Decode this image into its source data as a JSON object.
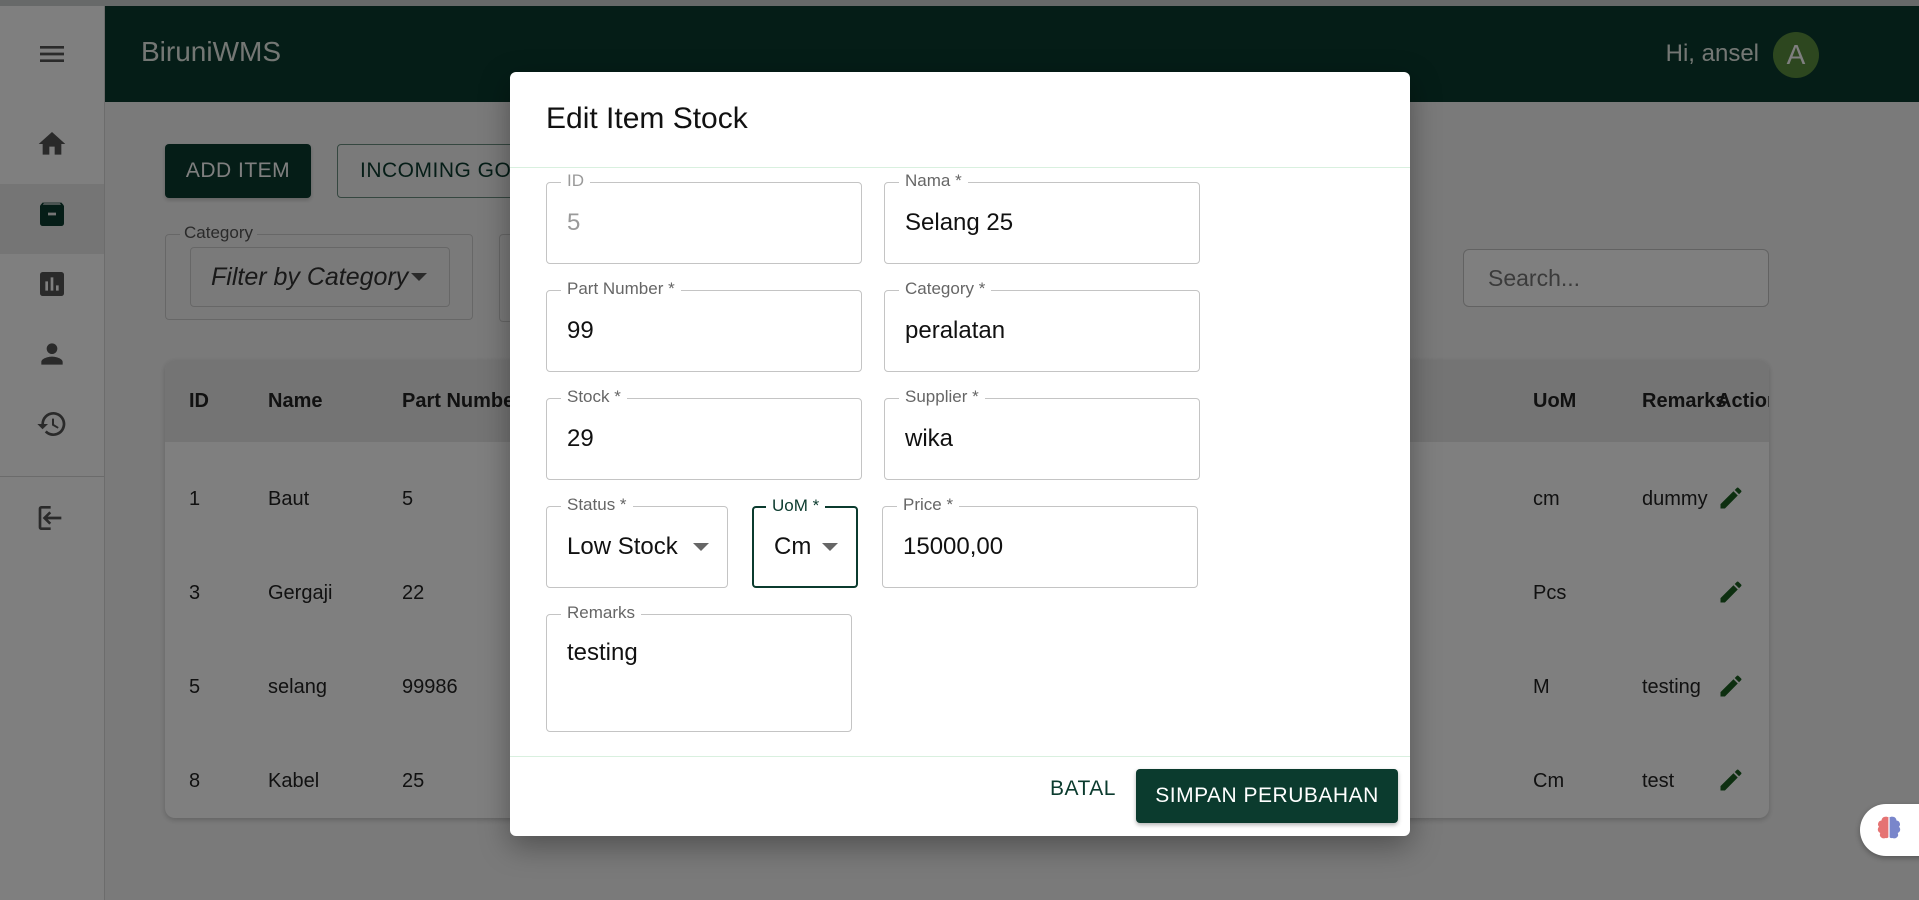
{
  "app": {
    "title": "BiruniWMS",
    "greeting": "Hi, ansel",
    "avatar_initial": "A"
  },
  "sidebar": {
    "items": [
      "menu-icon",
      "home-icon",
      "archive-icon",
      "chart-icon",
      "person-icon",
      "history-icon",
      "logout-icon"
    ]
  },
  "toolbar": {
    "add_label": "ADD ITEM",
    "incoming_label": "INCOMING GOODS"
  },
  "filter": {
    "legend": "Category",
    "value": "Filter by Category"
  },
  "search": {
    "placeholder": "Search..."
  },
  "table": {
    "columns": {
      "id": "ID",
      "name": "Name",
      "part": "Part Number",
      "uom": "UoM",
      "remarks": "Remarks",
      "action": "Action"
    },
    "rows": [
      {
        "id": "1",
        "name": "Baut",
        "part": "5",
        "uom": "cm",
        "remarks": "dummy"
      },
      {
        "id": "3",
        "name": "Gergaji",
        "part": "22",
        "uom": "Pcs",
        "remarks": ""
      },
      {
        "id": "5",
        "name": "selang",
        "part": "99986",
        "uom": "M",
        "remarks": "testing"
      },
      {
        "id": "8",
        "name": "Kabel",
        "part": "25",
        "uom": "Cm",
        "remarks": "test"
      }
    ]
  },
  "dialog": {
    "title": "Edit Item Stock",
    "fields": {
      "id": {
        "label": "ID",
        "value": "5"
      },
      "nama": {
        "label": "Nama *",
        "value": "Selang 25"
      },
      "part": {
        "label": "Part Number *",
        "value": "99"
      },
      "category": {
        "label": "Category *",
        "value": "peralatan"
      },
      "stock": {
        "label": "Stock *",
        "value": "29"
      },
      "supplier": {
        "label": "Supplier *",
        "value": "wika"
      },
      "status": {
        "label": "Status *",
        "value": "Low Stock"
      },
      "uom": {
        "label": "UoM *",
        "value": "Cm"
      },
      "price": {
        "label": "Price *",
        "value": "15000,00"
      },
      "remarks": {
        "label": "Remarks",
        "value": "testing"
      }
    },
    "cancel_label": "BATAL",
    "save_label": "SIMPAN PERUBAHAN"
  },
  "colors": {
    "primary": "#0b3b2e",
    "avatar": "#5a8f3e",
    "danger": "#c62828",
    "overlay": "rgba(0,0,0,0.5)"
  }
}
